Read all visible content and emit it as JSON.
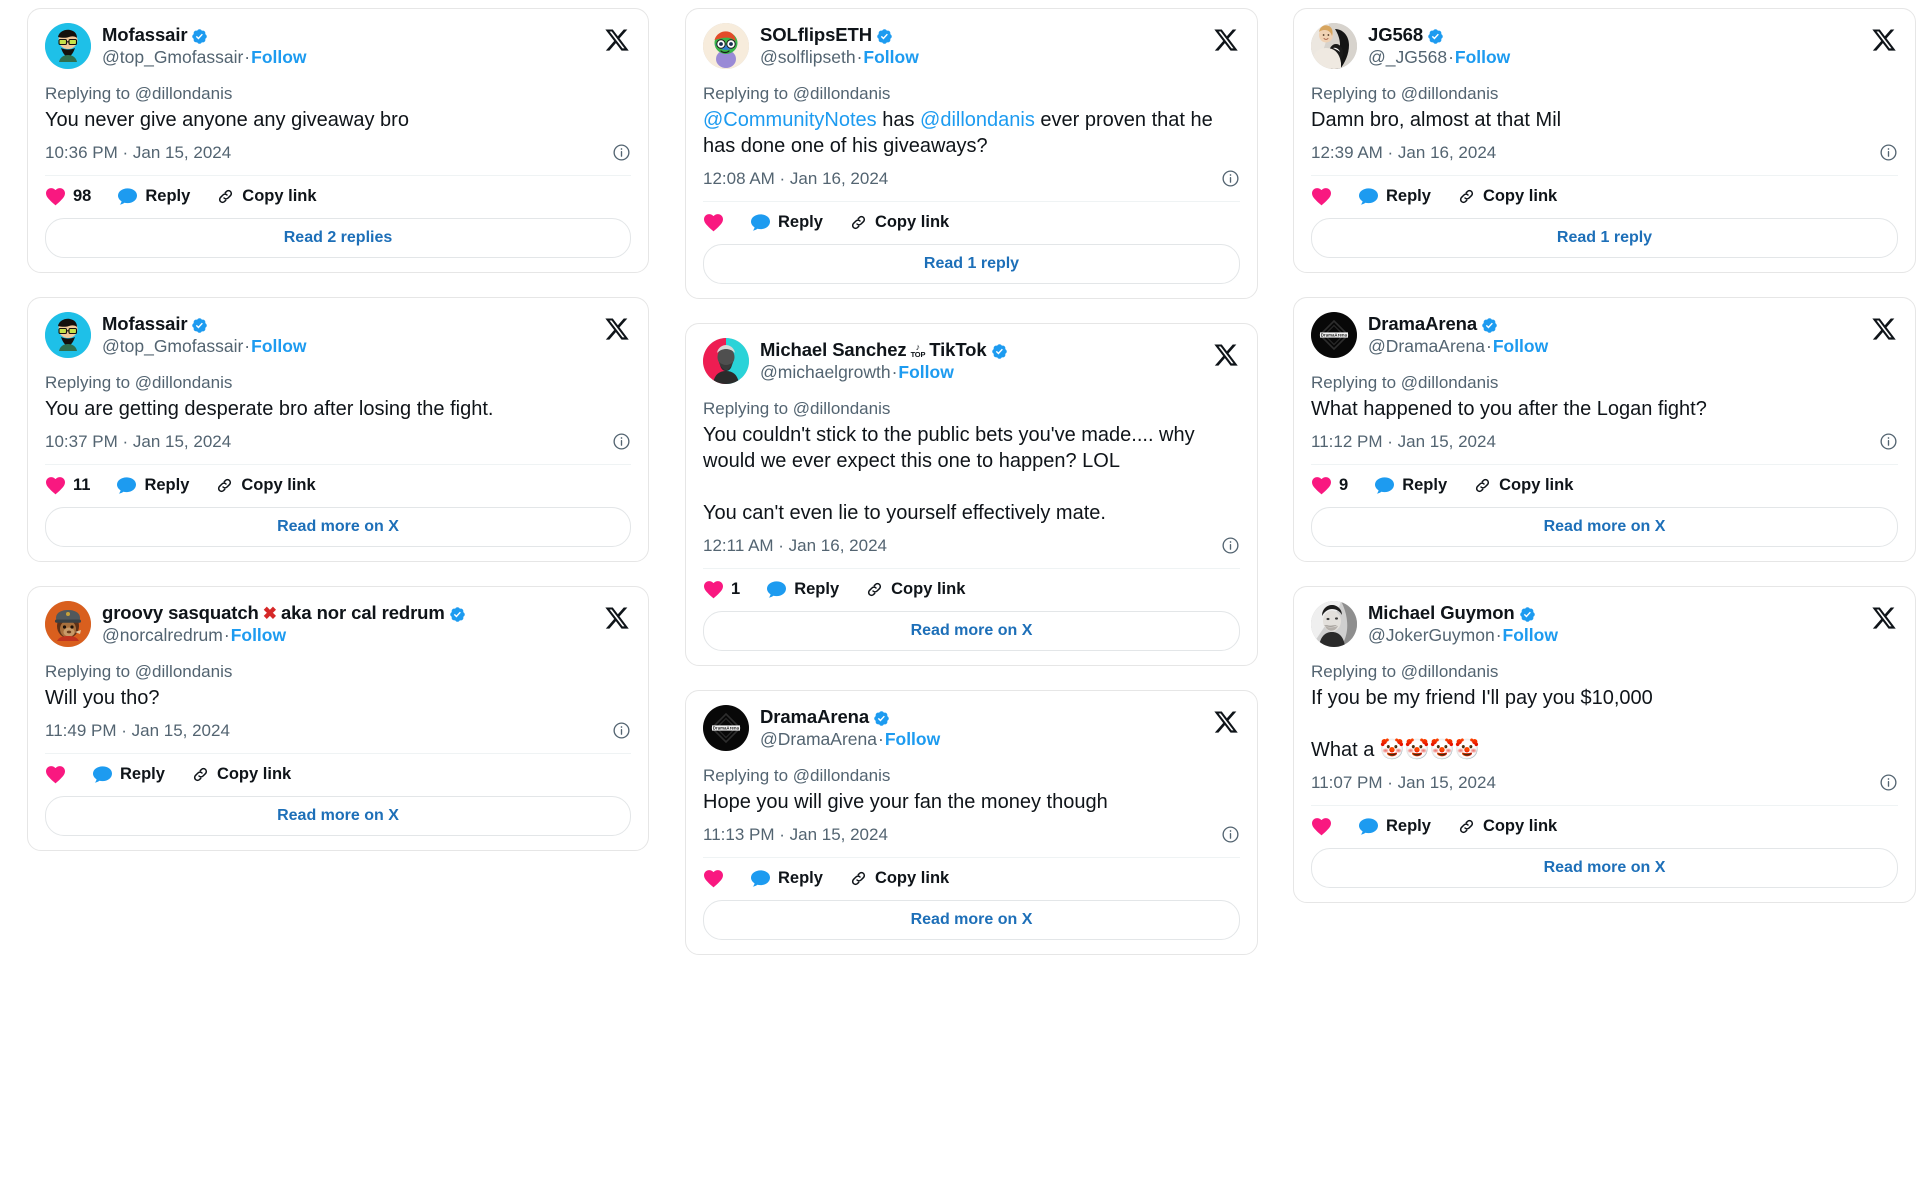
{
  "page": {
    "background": "#ffffff",
    "accent_blue": "#1d9bf0",
    "link_blue": "#1d6fb8",
    "heart_pink": "#f91880",
    "text_primary": "#0f1419",
    "text_muted": "#536471"
  },
  "labels": {
    "reply": "Reply",
    "copy_link": "Copy link",
    "follow": "Follow",
    "separator": "·"
  },
  "columns": [
    {
      "id": "col-0",
      "cards": [
        {
          "display_name": "Mofassair",
          "verified": true,
          "handle": "@top_Gmofassair",
          "follow": "Follow",
          "replying_to": "Replying to @dillondanis",
          "paragraphs": [
            [
              {
                "t": "You never give anyone any giveaway bro",
                "mention": false
              }
            ]
          ],
          "timestamp": "10:36 PM · Jan 15, 2024",
          "like_count": "98",
          "reply_label": "Reply",
          "copy_label": "Copy link",
          "read_more": "Read 2 replies",
          "avatar": "mofassair-avatar"
        },
        {
          "display_name": "Mofassair",
          "verified": true,
          "handle": "@top_Gmofassair",
          "follow": "Follow",
          "replying_to": "Replying to @dillondanis",
          "paragraphs": [
            [
              {
                "t": "You are getting desperate bro after losing the fight.",
                "mention": false
              }
            ]
          ],
          "timestamp": "10:37 PM · Jan 15, 2024",
          "like_count": "11",
          "reply_label": "Reply",
          "copy_label": "Copy link",
          "read_more": "Read more on X",
          "avatar": "mofassair-avatar"
        },
        {
          "display_name": "groovy sasquatch",
          "name_extra_x": "✖",
          "name_suffix": "aka nor cal redrum",
          "verified": true,
          "handle": "@norcalredrum",
          "follow": "Follow",
          "replying_to": "Replying to @dillondanis",
          "paragraphs": [
            [
              {
                "t": "Will you tho?",
                "mention": false
              }
            ]
          ],
          "timestamp": "11:49 PM · Jan 15, 2024",
          "like_count": "",
          "reply_label": "Reply",
          "copy_label": "Copy link",
          "read_more": "Read more on X",
          "avatar": "sasquatch-avatar"
        }
      ]
    },
    {
      "id": "col-1",
      "cards": [
        {
          "display_name": "SOLflipsETH",
          "verified": true,
          "handle": "@solflipseth",
          "follow": "Follow",
          "replying_to": "Replying to @dillondanis",
          "paragraphs": [
            [
              {
                "t": "@CommunityNotes",
                "mention": true
              },
              {
                "t": " has ",
                "mention": false
              },
              {
                "t": "@dillondanis",
                "mention": true
              },
              {
                "t": " ever proven that he has done one of his giveaways?",
                "mention": false
              }
            ]
          ],
          "timestamp": "12:08 AM · Jan 16, 2024",
          "like_count": "",
          "reply_label": "Reply",
          "copy_label": "Copy link",
          "read_more": "Read 1 reply",
          "avatar": "solflips-avatar"
        },
        {
          "display_name": "Michael Sanchez",
          "tiktok_badge": "TOP",
          "name_suffix": "TikTok",
          "verified": true,
          "handle": "@michaelgrowth",
          "follow": "Follow",
          "replying_to": "Replying to @dillondanis",
          "paragraphs": [
            [
              {
                "t": "You couldn't stick to the public bets you've made.... why would we ever expect this one to happen? LOL",
                "mention": false
              }
            ],
            [
              {
                "t": "You can't even lie to yourself effectively mate.",
                "mention": false
              }
            ]
          ],
          "timestamp": "12:11 AM · Jan 16, 2024",
          "like_count": "1",
          "reply_label": "Reply",
          "copy_label": "Copy link",
          "read_more": "Read more on X",
          "avatar": "sanchez-avatar"
        },
        {
          "display_name": "DramaArena",
          "verified": true,
          "handle": "@DramaArena",
          "follow": "Follow",
          "replying_to": "Replying to @dillondanis",
          "paragraphs": [
            [
              {
                "t": "Hope you will give your fan the money though",
                "mention": false
              }
            ]
          ],
          "timestamp": "11:13 PM · Jan 15, 2024",
          "like_count": "",
          "reply_label": "Reply",
          "copy_label": "Copy link",
          "read_more": "Read more on X",
          "avatar": "drama-avatar"
        }
      ]
    },
    {
      "id": "col-2",
      "cards": [
        {
          "display_name": "JG568",
          "verified": true,
          "handle": "@_JG568",
          "follow": "Follow",
          "replying_to": "Replying to @dillondanis",
          "paragraphs": [
            [
              {
                "t": "Damn bro, almost at that Mil",
                "mention": false
              }
            ]
          ],
          "timestamp": "12:39 AM · Jan 16, 2024",
          "like_count": "",
          "reply_label": "Reply",
          "copy_label": "Copy link",
          "read_more": "Read 1 reply",
          "avatar": "jg568-avatar"
        },
        {
          "display_name": "DramaArena",
          "verified": true,
          "handle": "@DramaArena",
          "follow": "Follow",
          "replying_to": "Replying to @dillondanis",
          "paragraphs": [
            [
              {
                "t": "What happened to you after the Logan fight?",
                "mention": false
              }
            ]
          ],
          "timestamp": "11:12 PM · Jan 15, 2024",
          "like_count": "9",
          "reply_label": "Reply",
          "copy_label": "Copy link",
          "read_more": "Read more on X",
          "avatar": "drama-avatar"
        },
        {
          "display_name": "Michael Guymon",
          "verified": true,
          "handle": "@JokerGuymon",
          "follow": "Follow",
          "replying_to": "Replying to @dillondanis",
          "paragraphs": [
            [
              {
                "t": "If you be my friend I'll pay you $10,000",
                "mention": false
              }
            ],
            [
              {
                "t": "What a 🤡🤡🤡🤡",
                "mention": false
              }
            ]
          ],
          "timestamp": "11:07 PM · Jan 15, 2024",
          "like_count": "",
          "reply_label": "Reply",
          "copy_label": "Copy link",
          "read_more": "Read more on X",
          "avatar": "guymon-avatar"
        }
      ]
    }
  ]
}
